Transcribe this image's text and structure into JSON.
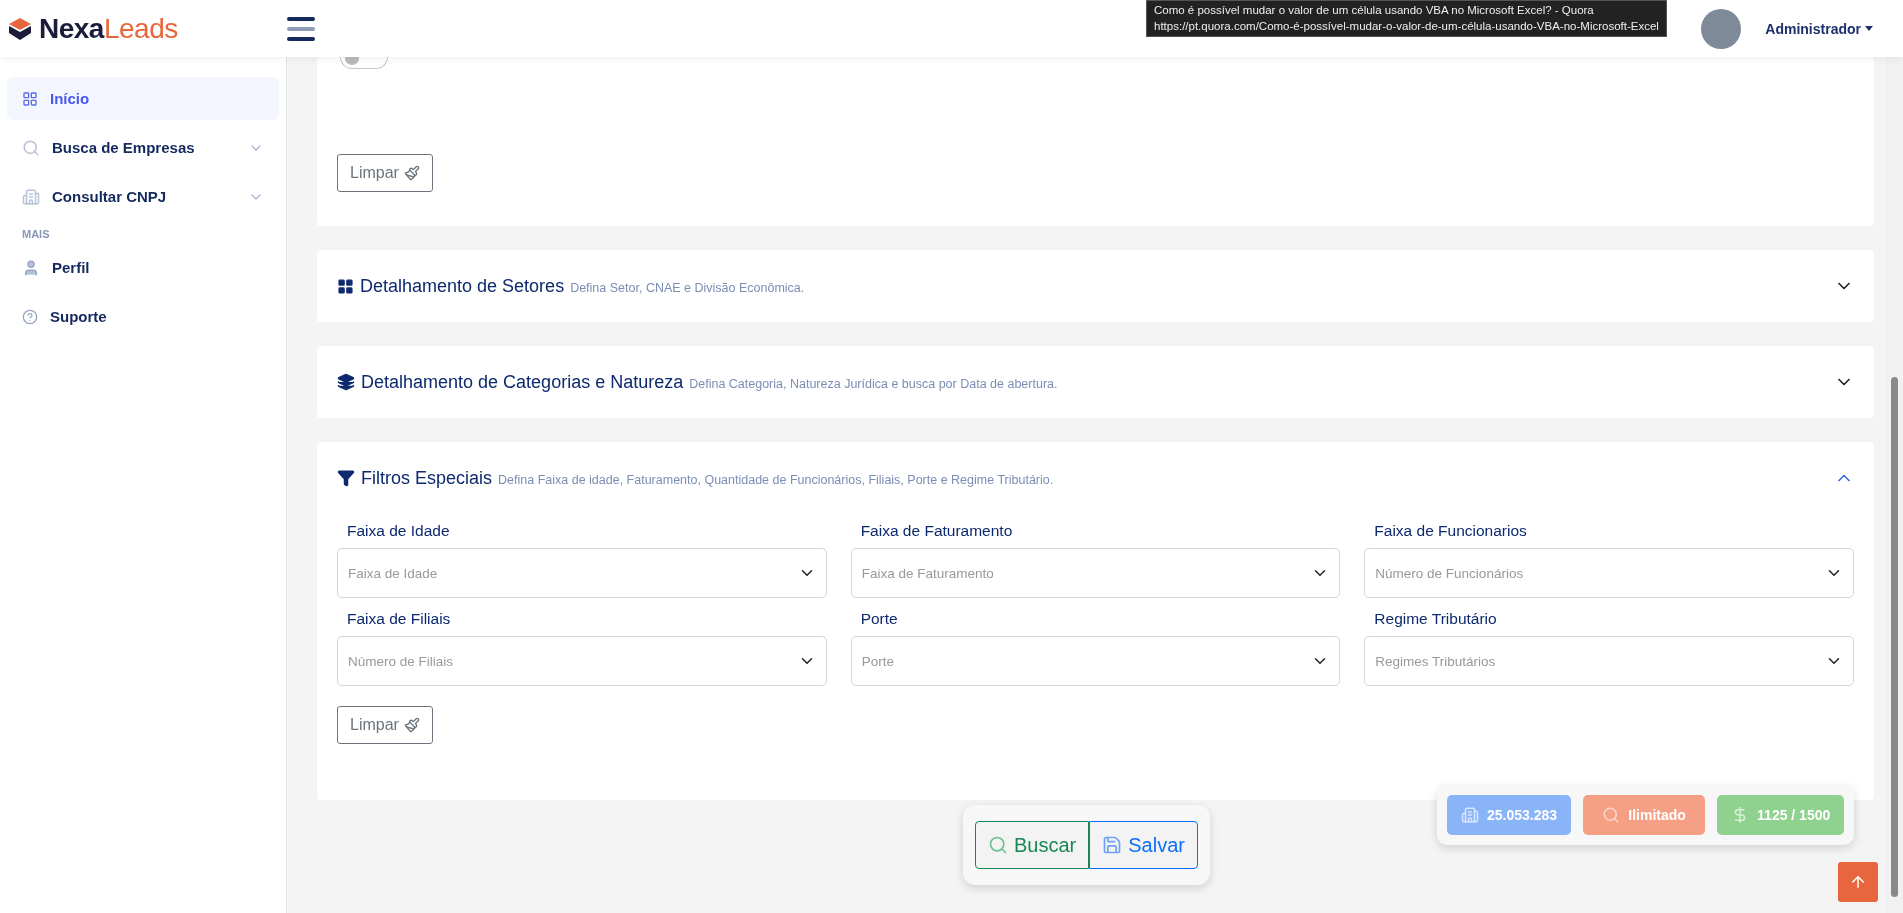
{
  "header": {
    "logo": {
      "primary": "Nexa",
      "secondary": "Leads"
    },
    "tooltip": {
      "title": "Como é possível mudar o valor de um célula usando VBA no Microsoft Excel? - Quora",
      "url": "https://pt.quora.com/Como-é-possível-mudar-o-valor-de-um-célula-usando-VBA-no-Microsoft-Excel"
    },
    "user": {
      "name": "Administrador"
    }
  },
  "sidebar": {
    "items": [
      {
        "kind": "home",
        "label": "Início",
        "selected": true,
        "expandable": false
      },
      {
        "kind": "search",
        "label": "Busca de Empresas",
        "selected": false,
        "expandable": true
      },
      {
        "kind": "company",
        "label": "Consultar CNPJ",
        "selected": false,
        "expandable": true
      },
      {
        "kind": "heading",
        "label": "MAIS"
      },
      {
        "kind": "profile",
        "label": "Perfil",
        "selected": false,
        "expandable": false
      },
      {
        "kind": "support",
        "label": "Suporte",
        "selected": false,
        "expandable": false
      }
    ]
  },
  "top_card": {
    "map_toggle": {
      "on": false
    },
    "clear_button": "Limpar"
  },
  "sections": [
    {
      "kind": "sectors",
      "title": "Detalhamento de Setores",
      "subtitle": "Defina Setor, CNAE e Divisão Econômica.",
      "expanded": false
    },
    {
      "kind": "categories",
      "title": "Detalhamento de Categorias e Natureza",
      "subtitle": "Defina Categoria, Natureza Jurídica e busca por Data de abertura.",
      "expanded": false
    },
    {
      "kind": "filters",
      "title": "Filtros Especiais",
      "subtitle": "Defina Faixa de idade, Faturamento, Quantidade de Funcionários, Filiais, Porte e Regime Tributário.",
      "expanded": true,
      "fields": [
        {
          "label": "Faixa de Idade",
          "placeholder": "Faixa de Idade"
        },
        {
          "label": "Faixa de Faturamento",
          "placeholder": "Faixa de Faturamento"
        },
        {
          "label": "Faixa de Funcionarios",
          "placeholder": "Número de Funcionários"
        },
        {
          "label": "Faixa de Filiais",
          "placeholder": "Número de Filiais"
        },
        {
          "label": "Porte",
          "placeholder": "Porte"
        },
        {
          "label": "Regime Tributário",
          "placeholder": "Regimes Tributários"
        }
      ],
      "clear_button": "Limpar"
    }
  ],
  "actions": {
    "search": "Buscar",
    "save": "Salvar"
  },
  "stats": [
    {
      "kind": "companies",
      "value": "25.053.283",
      "color": "#8ab4f8"
    },
    {
      "kind": "searches",
      "value": "Ilimitado",
      "color": "#f5a085"
    },
    {
      "kind": "credits",
      "value": "1125 / 1500",
      "color": "#8fd18f"
    }
  ]
}
